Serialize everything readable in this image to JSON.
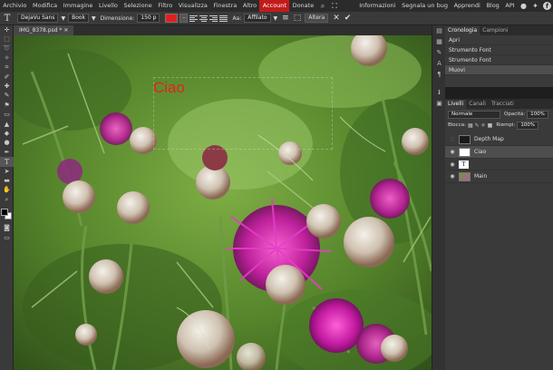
{
  "menu": [
    "Archivio",
    "Modifica",
    "Immagine",
    "Livello",
    "Selezione",
    "Filtro",
    "Visualizza",
    "Finestra",
    "Altro",
    "Account",
    "Donate"
  ],
  "menu_active": "Account",
  "menu_right": [
    "Informazioni",
    "Segnala un bug",
    "Apprendi",
    "Blog",
    "API"
  ],
  "options": {
    "font": "DejaVu Sans",
    "style": "Book",
    "size_label": "Dimensione:",
    "size_value": "150 p",
    "color": "#e41e1e",
    "aa_label": "Aa:",
    "aa_value": "Affilato",
    "alter_label": "Altera"
  },
  "document_tab": "IMG_8378.psd *",
  "canvas": {
    "text": "Ciao",
    "text_color": "#e4231e"
  },
  "history_panel": {
    "tabs": [
      "Cronologia",
      "Campioni"
    ],
    "items": [
      "Apri",
      "Strumento Font",
      "Strumento Font",
      "Muovi"
    ],
    "selected": "Muovi"
  },
  "layers_panel": {
    "tabs": [
      "Livelli",
      "Canali",
      "Tracciati"
    ],
    "blend_mode": "Normale",
    "opacity_label": "Opacità:",
    "opacity_value": "100%",
    "lock_label": "Blocca:",
    "fill_label": "Riempi:",
    "fill_value": "100%",
    "layers": [
      "Depth Map",
      "Ciao",
      "Main"
    ],
    "selected": "Ciao"
  }
}
